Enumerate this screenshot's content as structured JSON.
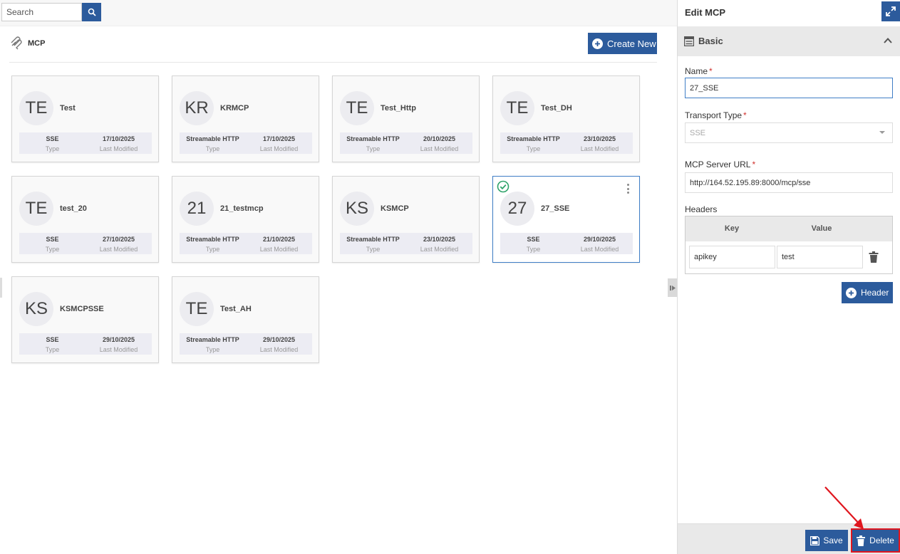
{
  "search": {
    "placeholder": "Search"
  },
  "section": {
    "title": "MCP",
    "create_label": "Create New"
  },
  "cards": [
    {
      "initials": "TE",
      "name": "Test",
      "type": "SSE",
      "type_label": "Type",
      "date": "17/10/2025",
      "date_label": "Last Modified"
    },
    {
      "initials": "KR",
      "name": "KRMCP",
      "type": "Streamable HTTP",
      "type_label": "Type",
      "date": "17/10/2025",
      "date_label": "Last Modified"
    },
    {
      "initials": "TE",
      "name": "Test_Http",
      "type": "Streamable HTTP",
      "type_label": "Type",
      "date": "20/10/2025",
      "date_label": "Last Modified"
    },
    {
      "initials": "TE",
      "name": "Test_DH",
      "type": "Streamable HTTP",
      "type_label": "Type",
      "date": "23/10/2025",
      "date_label": "Last Modified"
    },
    {
      "initials": "TE",
      "name": "test_20",
      "type": "SSE",
      "type_label": "Type",
      "date": "27/10/2025",
      "date_label": "Last Modified"
    },
    {
      "initials": "21",
      "name": "21_testmcp",
      "type": "Streamable HTTP",
      "type_label": "Type",
      "date": "21/10/2025",
      "date_label": "Last Modified"
    },
    {
      "initials": "KS",
      "name": "KSMCP",
      "type": "Streamable HTTP",
      "type_label": "Type",
      "date": "23/10/2025",
      "date_label": "Last Modified"
    },
    {
      "initials": "27",
      "name": "27_SSE",
      "type": "SSE",
      "type_label": "Type",
      "date": "29/10/2025",
      "date_label": "Last Modified",
      "selected": true
    },
    {
      "initials": "KS",
      "name": "KSMCPSSE",
      "type": "SSE",
      "type_label": "Type",
      "date": "29/10/2025",
      "date_label": "Last Modified"
    },
    {
      "initials": "TE",
      "name": "Test_AH",
      "type": "Streamable HTTP",
      "type_label": "Type",
      "date": "29/10/2025",
      "date_label": "Last Modified"
    }
  ],
  "panel": {
    "title": "Edit MCP",
    "basic_label": "Basic",
    "name_label": "Name",
    "name_value": "27_SSE",
    "transport_label": "Transport Type",
    "transport_value": "SSE",
    "url_label": "MCP Server URL",
    "url_value": "http://164.52.195.89:8000/mcp/sse",
    "headers_label": "Headers",
    "headers_key_col": "Key",
    "headers_value_col": "Value",
    "headers_rows": [
      {
        "key": "apikey",
        "value": "test"
      }
    ],
    "add_header_label": "Header",
    "save_label": "Save",
    "delete_label": "Delete",
    "required_mark": "*"
  },
  "colors": {
    "primary": "#2c5b9c",
    "selected_border": "#3f7ec6",
    "highlight": "#e0161e",
    "success": "#2ea36a"
  }
}
